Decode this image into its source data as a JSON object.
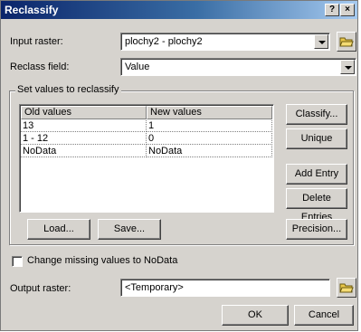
{
  "window": {
    "title": "Reclassify",
    "help_label": "?",
    "close_label": "×"
  },
  "input_raster": {
    "label": "Input raster:",
    "value": "plochy2 - plochy2"
  },
  "reclass_field": {
    "label": "Reclass field:",
    "value": "Value"
  },
  "group": {
    "title": "Set values to reclassify"
  },
  "table": {
    "columns": [
      "Old values",
      "New values"
    ],
    "rows": [
      {
        "old": "13",
        "new": "1"
      },
      {
        "old": "1 - 12",
        "new": "0"
      },
      {
        "old": "NoData",
        "new": "NoData"
      }
    ]
  },
  "buttons": {
    "classify": "Classify...",
    "unique": "Unique",
    "add_entry": "Add Entry",
    "delete_entries": "Delete Entries",
    "load": "Load...",
    "save": "Save...",
    "precision": "Precision...",
    "ok": "OK",
    "cancel": "Cancel"
  },
  "missing_checkbox": {
    "label": "Change missing values to NoData",
    "checked": false
  },
  "output_raster": {
    "label": "Output raster:",
    "value": "<Temporary>"
  },
  "icons": {
    "browse": "open-folder-icon",
    "dropdown": "chevron-down-icon"
  }
}
